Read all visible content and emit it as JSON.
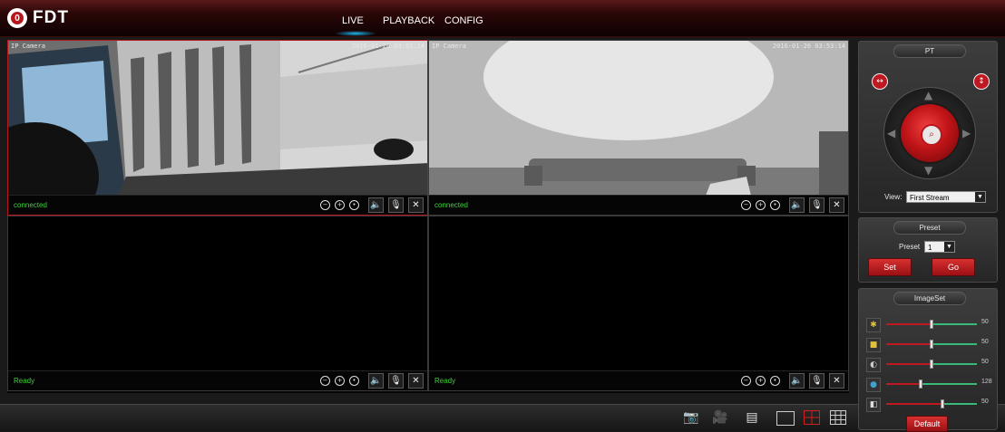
{
  "header": {
    "logo_text": "FDT",
    "nav": [
      {
        "label": "LIVE",
        "active": true
      },
      {
        "label": "PLAYBACK",
        "active": false
      },
      {
        "label": "CONFIG",
        "active": false
      }
    ]
  },
  "channels": [
    {
      "name": "IP Camera",
      "timestamp": "2016-01-26 03:53:14",
      "status": "connected",
      "selected": true
    },
    {
      "name": "IP Camera",
      "timestamp": "2016-01-26 03:53:14",
      "status": "connected",
      "selected": false
    },
    {
      "status": "Ready",
      "selected": false
    },
    {
      "status": "Ready",
      "selected": false
    }
  ],
  "ptz": {
    "title": "PT",
    "view_label": "View:",
    "view_value": "First Stream"
  },
  "preset": {
    "title": "Preset",
    "label": "Preset",
    "value": "1",
    "set_label": "Set",
    "go_label": "Go"
  },
  "imageset": {
    "title": "ImageSet",
    "sliders": [
      {
        "icon": "brightness-icon",
        "value": 50,
        "level": 0.5
      },
      {
        "icon": "contrast-icon",
        "value": 50,
        "level": 0.5
      },
      {
        "icon": "hue-icon",
        "value": 50,
        "level": 0.5
      },
      {
        "icon": "saturation-icon",
        "value": 128,
        "level": 0.38
      },
      {
        "icon": "sharpness-icon",
        "value": 50,
        "level": 0.62
      }
    ],
    "default_label": "Default"
  },
  "colors": {
    "accent_red": "#b8181d",
    "status_green": "#3ad23a",
    "nav_glow": "#1ec0f0"
  }
}
